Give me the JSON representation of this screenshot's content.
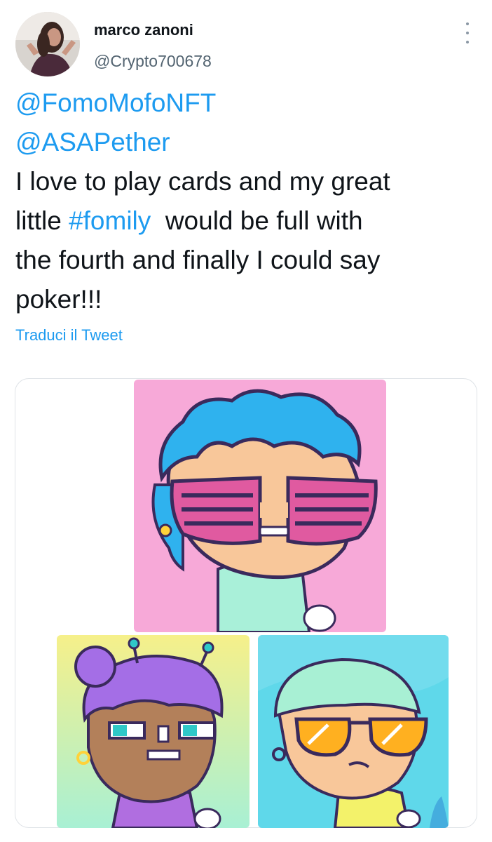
{
  "author": {
    "display_name": "marco zanoni",
    "handle": "@Crypto700678",
    "avatar_icon": "profile-photo"
  },
  "menu": {
    "icon": "more-vertical-icon"
  },
  "tweet": {
    "mention_1": "@FomoMofoNFT",
    "mention_2": "@ASAPether",
    "line_1": "I love to play cards and my great",
    "line_2_before": "little ",
    "hashtag": "#fomily",
    "line_2_after": "  would be full with",
    "line_3": "the fourth and finally I could say",
    "line_4": "poker!!!"
  },
  "translate_label": "Traduci il Tweet",
  "media": {
    "count": 3,
    "images": [
      {
        "subject": "nft-character-blue-hair-pink-shutter-glasses",
        "background": "#f7a9d8"
      },
      {
        "subject": "nft-character-purple-hair-antennae",
        "background": "#f2f0a0"
      },
      {
        "subject": "nft-character-mint-hair-orange-sunglasses",
        "background": "#5fd8ea"
      }
    ]
  },
  "colors": {
    "link": "#1d9bf0",
    "text": "#0f1419",
    "secondary": "#536471"
  }
}
